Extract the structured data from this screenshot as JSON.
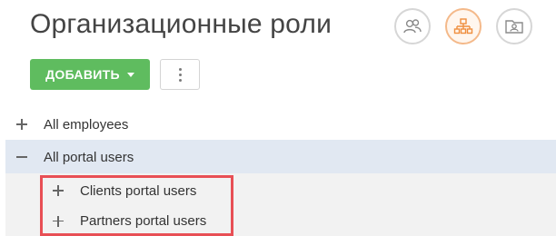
{
  "header": {
    "title": "Организационные роли",
    "views": [
      {
        "icon": "employees-view-icon",
        "active": false
      },
      {
        "icon": "org-structure-view-icon",
        "active": true
      },
      {
        "icon": "portal-view-icon",
        "active": false
      }
    ]
  },
  "toolbar": {
    "add_label": "ДОБАВИТЬ",
    "add_color": "#5fbc5f",
    "more_icon": "vertical-dots-icon"
  },
  "tree": {
    "items": [
      {
        "label": "All employees",
        "toggle": "+",
        "level": 0,
        "selected": false
      },
      {
        "label": "All portal users",
        "toggle": "−",
        "level": 0,
        "selected": true
      },
      {
        "label": "Clients portal users",
        "toggle": "+",
        "level": 1,
        "selected": false
      },
      {
        "label": "Partners portal users",
        "toggle": "+",
        "level": 1,
        "selected": false
      }
    ],
    "selected_row_color": "#e1e8f2",
    "child_row_color": "#f2f2f2"
  },
  "highlight": {
    "color": "#e84f55"
  }
}
